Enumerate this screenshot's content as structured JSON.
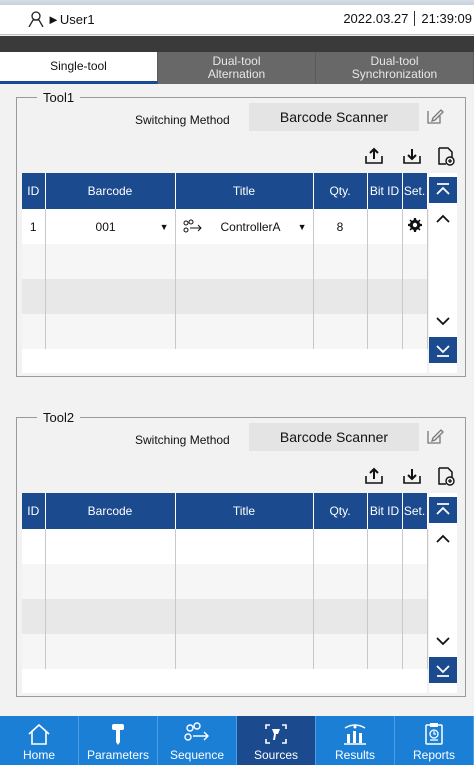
{
  "status": {
    "user": "►User1",
    "date": "2022.03.27",
    "time": "21:39:09"
  },
  "tabs": [
    {
      "label": "Single-tool"
    },
    {
      "label_1": "Dual-tool",
      "label_2": "Alternation"
    },
    {
      "label_1": "Dual-tool",
      "label_2": "Synchronization"
    }
  ],
  "tool1": {
    "title": "Tool1",
    "switch_label": "Switching Method",
    "switch_value": "Barcode Scanner",
    "columns": [
      "ID",
      "Barcode",
      "Title",
      "Qty.",
      "Bit ID",
      "Set."
    ],
    "rows": [
      {
        "id": "1",
        "barcode": "001",
        "title": "ControllerA",
        "qty": "8",
        "bit_id": ""
      }
    ]
  },
  "tool2": {
    "title": "Tool2",
    "switch_label": "Switching Method",
    "switch_value": "Barcode Scanner",
    "columns": [
      "ID",
      "Barcode",
      "Title",
      "Qty.",
      "Bit ID",
      "Set."
    ],
    "rows": []
  },
  "nav": [
    {
      "label": "Home",
      "icon": "home-icon"
    },
    {
      "label": "Parameters",
      "icon": "screw-icon"
    },
    {
      "label": "Sequence",
      "icon": "sequence-icon"
    },
    {
      "label": "Sources",
      "icon": "scanner-icon"
    },
    {
      "label": "Results",
      "icon": "chart-icon"
    },
    {
      "label": "Reports",
      "icon": "report-icon"
    }
  ],
  "colors": {
    "header_blue": "#1b4a8e",
    "nav_blue": "#1b7fd6"
  }
}
